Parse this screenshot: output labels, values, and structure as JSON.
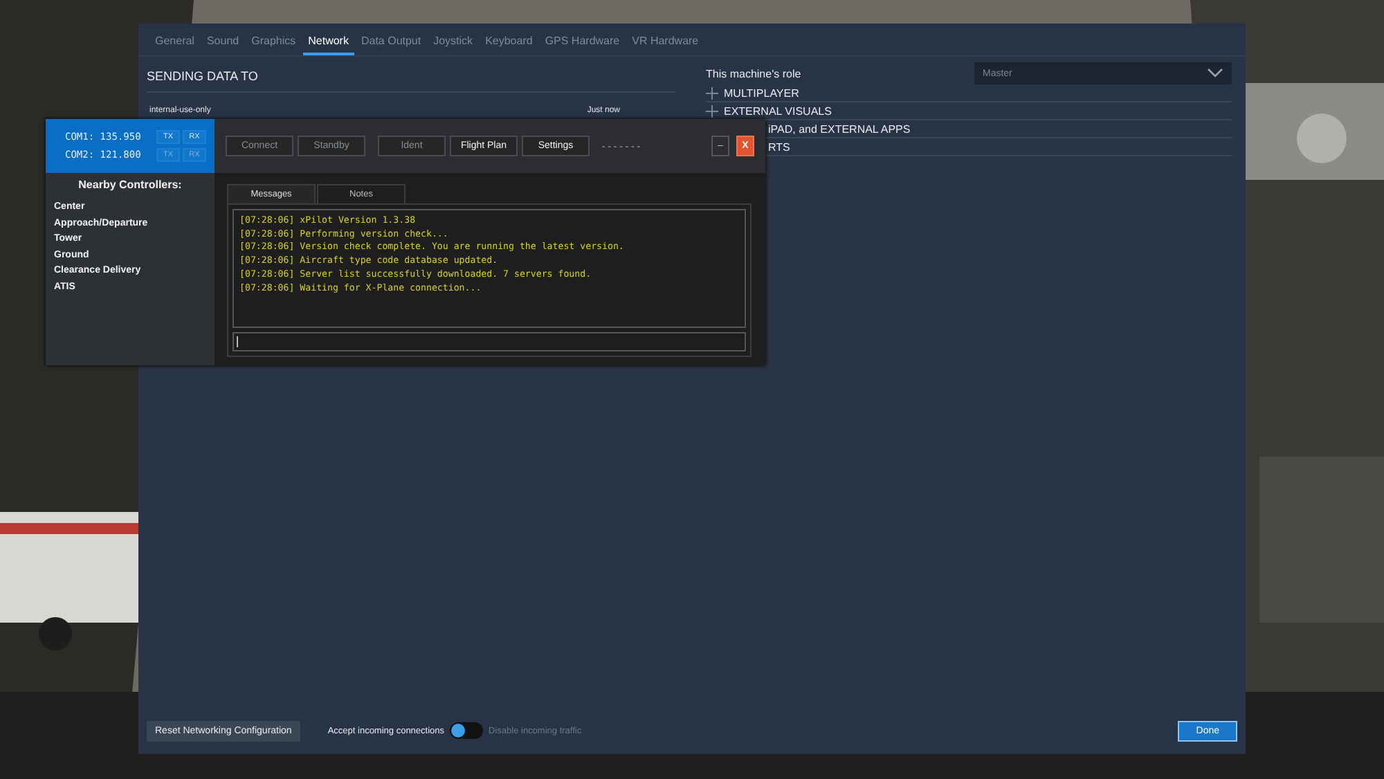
{
  "settings_window": {
    "tabs": [
      {
        "label": "General",
        "selected": false
      },
      {
        "label": "Sound",
        "selected": false
      },
      {
        "label": "Graphics",
        "selected": false
      },
      {
        "label": "Network",
        "selected": true
      },
      {
        "label": "Data Output",
        "selected": false
      },
      {
        "label": "Joystick",
        "selected": false
      },
      {
        "label": "Keyboard",
        "selected": false
      },
      {
        "label": "GPS Hardware",
        "selected": false
      },
      {
        "label": "VR Hardware",
        "selected": false
      }
    ],
    "sending_title": "SENDING DATA TO",
    "sending_row": {
      "name": "internal-use-only",
      "time": "Just now"
    },
    "role_label": "This machine's role",
    "role_value": "Master",
    "sections": [
      {
        "label": "MULTIPLAYER",
        "kind": "full"
      },
      {
        "label": "EXTERNAL VISUALS",
        "kind": "full"
      },
      {
        "label": "iPAD, and EXTERNAL APPS",
        "kind": "cut"
      },
      {
        "label": "RTS",
        "kind": "cut"
      }
    ],
    "reset_button": "Reset Networking Configuration",
    "toggle": {
      "label_on": "Accept incoming connections",
      "label_off": "Disable incoming traffic",
      "on": true
    },
    "done_button": "Done"
  },
  "xpilot": {
    "radios": [
      {
        "label": "COM1: 135.950",
        "tx": "TX",
        "rx": "RX",
        "active": true
      },
      {
        "label": "COM2: 121.800",
        "tx": "TX",
        "rx": "RX",
        "active": false
      }
    ],
    "controllers_title": "Nearby Controllers:",
    "controllers": [
      "Center",
      "Approach/Departure",
      "Tower",
      "Ground",
      "Clearance Delivery",
      "ATIS"
    ],
    "buttons": [
      {
        "label": "Connect",
        "disabled": true
      },
      {
        "label": "Standby",
        "disabled": true
      },
      {
        "label": "Ident",
        "disabled": true
      },
      {
        "label": "Flight Plan",
        "disabled": false
      },
      {
        "label": "Settings",
        "disabled": false
      }
    ],
    "status": "-------",
    "minimize": "–",
    "close": "X",
    "tabs": [
      {
        "label": "Messages",
        "selected": true
      },
      {
        "label": "Notes",
        "selected": false
      }
    ],
    "messages": [
      "[07:28:06] xPilot Version 1.3.38",
      "[07:28:06] Performing version check...",
      "[07:28:06] Version check complete. You are running the latest version.",
      "[07:28:06] Aircraft type code database updated.",
      "[07:28:06] Server list successfully downloaded. 7 servers found.",
      "[07:28:06] Waiting for X-Plane connection..."
    ]
  }
}
